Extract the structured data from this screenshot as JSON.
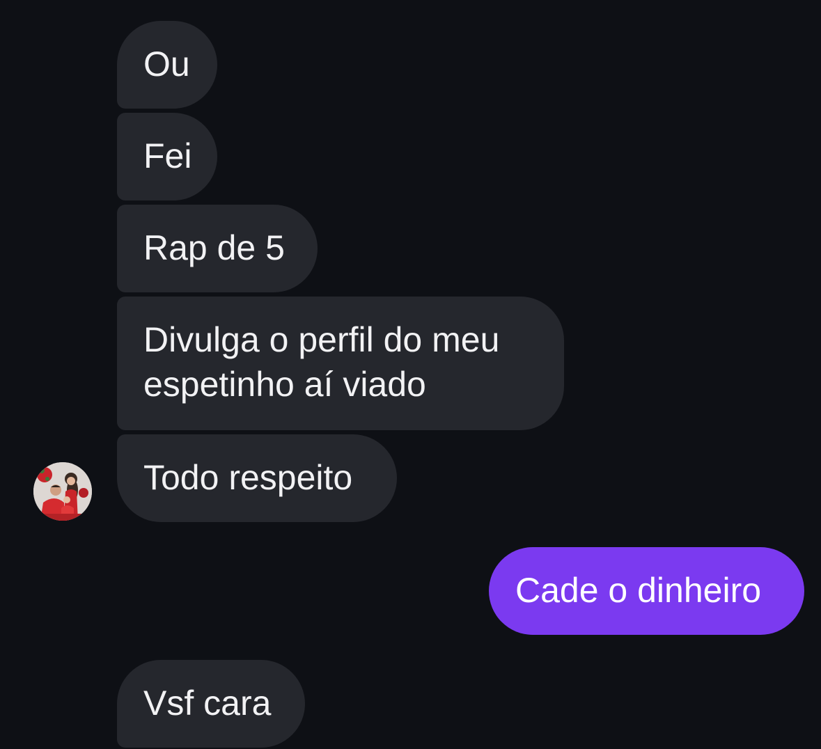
{
  "conversation": {
    "messages": [
      {
        "sender": "contact",
        "text": "Ou"
      },
      {
        "sender": "contact",
        "text": "Fei"
      },
      {
        "sender": "contact",
        "text": "Rap de 5"
      },
      {
        "sender": "contact",
        "text": "Divulga o perfil do meu\nespetinho aí viado"
      },
      {
        "sender": "contact",
        "text": "Todo respeito"
      },
      {
        "sender": "me",
        "text": "Cade o dinheiro"
      },
      {
        "sender": "contact",
        "text": "Vsf cara"
      }
    ]
  },
  "colors": {
    "background": "#0e1015",
    "incoming_bubble": "#25272d",
    "outgoing_bubble": "#7b3af0"
  },
  "icons": {
    "avatar": "contact-avatar-photo"
  }
}
